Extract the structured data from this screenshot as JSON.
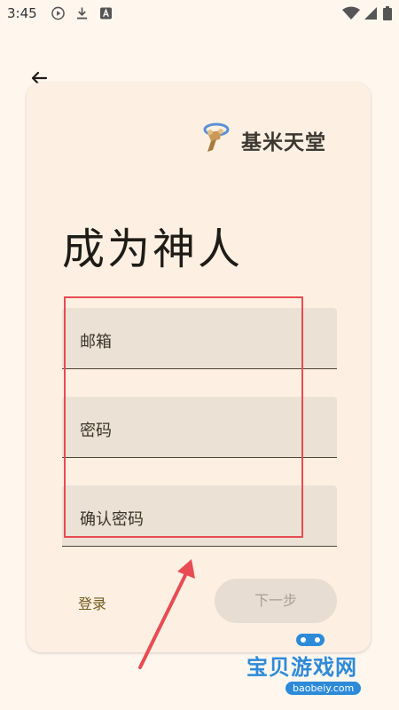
{
  "status_bar": {
    "time": "3:45"
  },
  "header": {
    "brand": "基米天堂"
  },
  "page": {
    "title": "成为神人"
  },
  "form": {
    "email_label": "邮箱",
    "password_label": "密码",
    "confirm_password_label": "确认密码"
  },
  "actions": {
    "login_label": "登录",
    "next_label": "下一步"
  },
  "watermark": {
    "text": "宝贝游戏网",
    "url": "baobeiy.com"
  },
  "colors": {
    "background": "#fff7ee",
    "card": "#fdf0e2",
    "field": "#ebe1d5",
    "annotation": "#e84b53",
    "link": "#6f5b1f"
  }
}
